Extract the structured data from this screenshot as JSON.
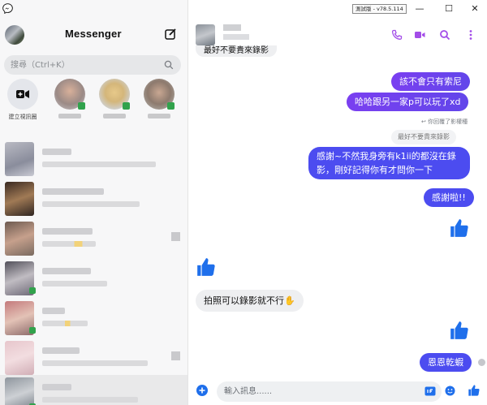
{
  "app": {
    "title": "Messenger",
    "version": "測試版 - v78.5.114"
  },
  "search": {
    "placeholder": "搜尋（Ctrl+K）"
  },
  "stories": {
    "create_room_label": "建立視訊圈"
  },
  "composer": {
    "placeholder": "輸入訊息......"
  },
  "colors": {
    "accent": "#6b3ff2",
    "like_blue": "#1f6feb",
    "online": "#31a24c"
  },
  "messages": {
    "top_partial": "最好不要貴來錄影",
    "m1": "該不會只有索尼",
    "m2": "哈哈跟另一家p可以玩了xd",
    "reply_note": "你回覆了影權種",
    "reply_quote": "最好不要貴來錄影",
    "m3_line1": "感謝~不然我身旁有k1ii的都沒在錄",
    "m3_line2": "影，剛好記得你有才問你一下",
    "m4": "感謝啦!!",
    "m5": "拍照可以錄影就不行✋",
    "m6": "恩恩乾蝦"
  },
  "icons": {
    "logo": "messenger-logo-icon",
    "compose": "compose-icon",
    "search": "search-icon",
    "call": "phone-icon",
    "video": "video-camera-icon",
    "header_search": "search-icon",
    "more": "more-vertical-icon",
    "add": "plus-circle-icon",
    "gif": "gif-icon",
    "emoji": "emoji-icon",
    "like": "thumbs-up-icon"
  }
}
